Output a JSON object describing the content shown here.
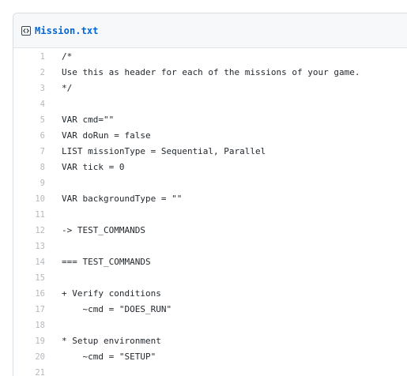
{
  "file": {
    "name": "Mission.txt",
    "icon": "code-file-icon"
  },
  "lines": [
    {
      "number": "1",
      "code": "/*"
    },
    {
      "number": "2",
      "code": "Use this as header for each of the missions of your game."
    },
    {
      "number": "3",
      "code": "*/"
    },
    {
      "number": "4",
      "code": ""
    },
    {
      "number": "5",
      "code": "VAR cmd=\"\""
    },
    {
      "number": "6",
      "code": "VAR doRun = false"
    },
    {
      "number": "7",
      "code": "LIST missionType = Sequential, Parallel"
    },
    {
      "number": "8",
      "code": "VAR tick = 0"
    },
    {
      "number": "9",
      "code": ""
    },
    {
      "number": "10",
      "code": "VAR backgroundType = \"\""
    },
    {
      "number": "11",
      "code": ""
    },
    {
      "number": "12",
      "code": "-> TEST_COMMANDS"
    },
    {
      "number": "13",
      "code": ""
    },
    {
      "number": "14",
      "code": "=== TEST_COMMANDS"
    },
    {
      "number": "15",
      "code": ""
    },
    {
      "number": "16",
      "code": "+ Verify conditions"
    },
    {
      "number": "17",
      "code": "    ~cmd = \"DOES_RUN\""
    },
    {
      "number": "18",
      "code": ""
    },
    {
      "number": "19",
      "code": "* Setup environment"
    },
    {
      "number": "20",
      "code": "    ~cmd = \"SETUP\""
    },
    {
      "number": "21",
      "code": ""
    }
  ],
  "colors": {
    "link": "#0366d6",
    "line_number": "#b5b9bd",
    "code_text": "#24292e",
    "header_background": "#f6f8fa",
    "border": "#d9dee3"
  }
}
